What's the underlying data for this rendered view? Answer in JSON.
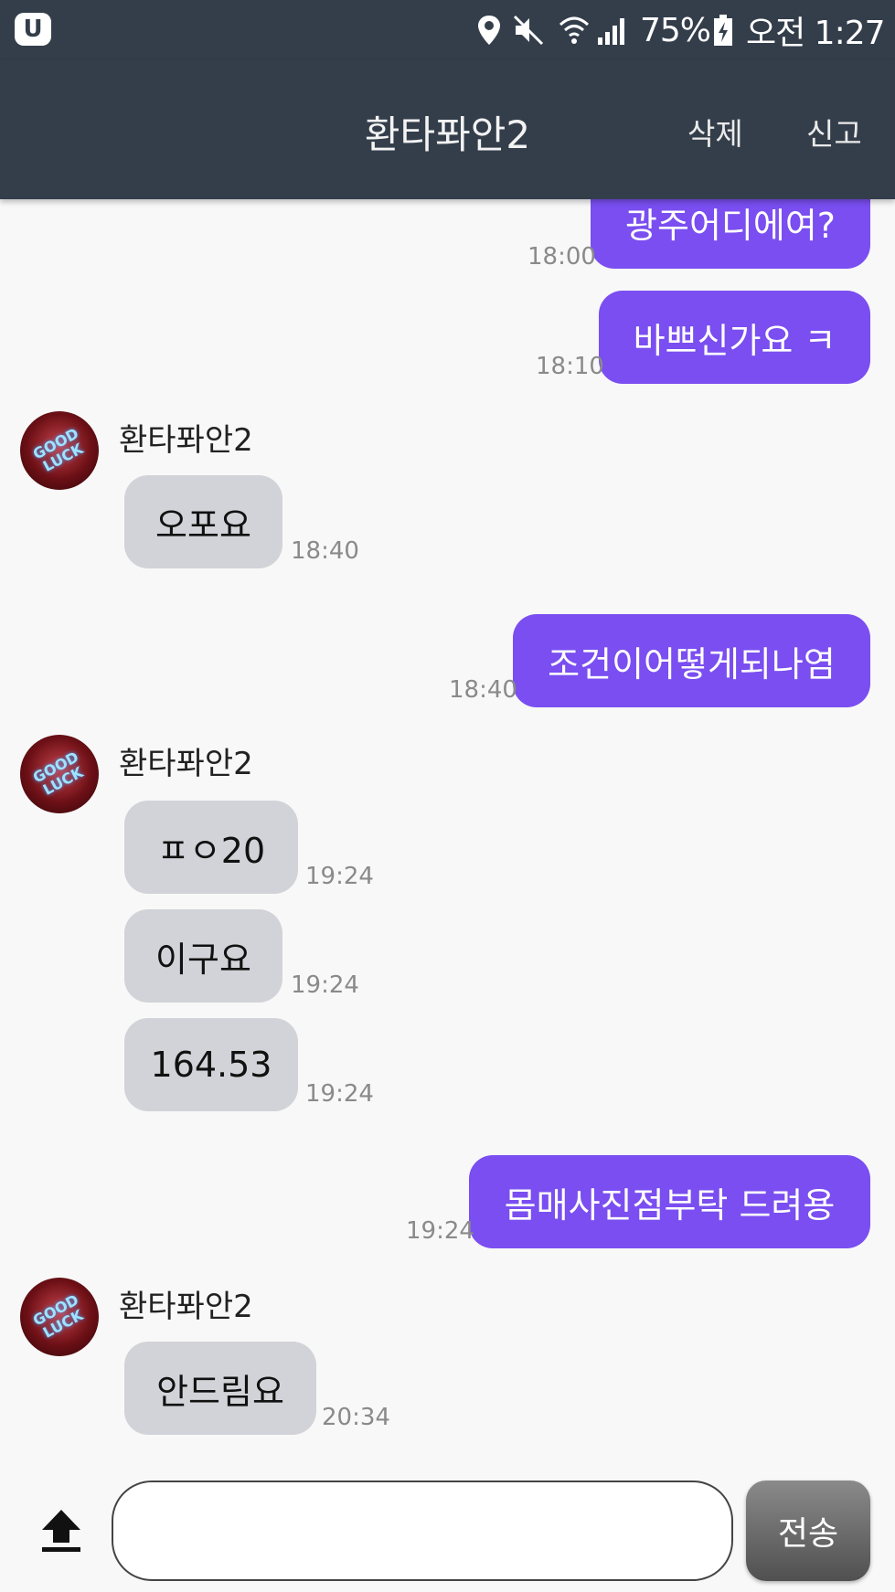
{
  "status_bar": {
    "app_icon": "u-plus-icon",
    "icons": [
      "location-icon",
      "mute-icon",
      "wifi-icon",
      "signal-icon"
    ],
    "battery_percent": "75%",
    "battery_icon": "battery-charging-icon",
    "clock": "오전 1:27"
  },
  "header": {
    "title": "환타퐈안2",
    "delete_label": "삭제",
    "report_label": "신고"
  },
  "avatar_text": "GOOD LUCK",
  "messages": [
    {
      "sender": "me",
      "text": "광주어디에여?",
      "time": "18:00"
    },
    {
      "sender": "me",
      "text": "바쁘신가요 ㅋ",
      "time": "18:10"
    },
    {
      "sender": "them",
      "name": "환타퐈안2",
      "text": "오포요",
      "time": "18:40"
    },
    {
      "sender": "me",
      "text": "조건이어떻게되나염",
      "time": "18:40"
    },
    {
      "sender": "them",
      "name": "환타퐈안2",
      "text": "ㅍㅇ20",
      "time": "19:24"
    },
    {
      "sender": "them",
      "text": "이구요",
      "time": "19:24"
    },
    {
      "sender": "them",
      "text": "164.53",
      "time": "19:24"
    },
    {
      "sender": "me",
      "text": "몸매사진점부탁 드려용",
      "time": "19:24"
    },
    {
      "sender": "them",
      "name": "환타퐈안2",
      "text": "안드림요",
      "time": "20:34"
    }
  ],
  "input": {
    "upload_icon": "upload-arrow-icon",
    "placeholder": "",
    "value": "",
    "send_label": "전송"
  },
  "colors": {
    "header_bg": "#343e4b",
    "my_bubble": "#7a4ef0",
    "their_bubble": "#d2d3d8",
    "background": "#f8f8f8"
  }
}
